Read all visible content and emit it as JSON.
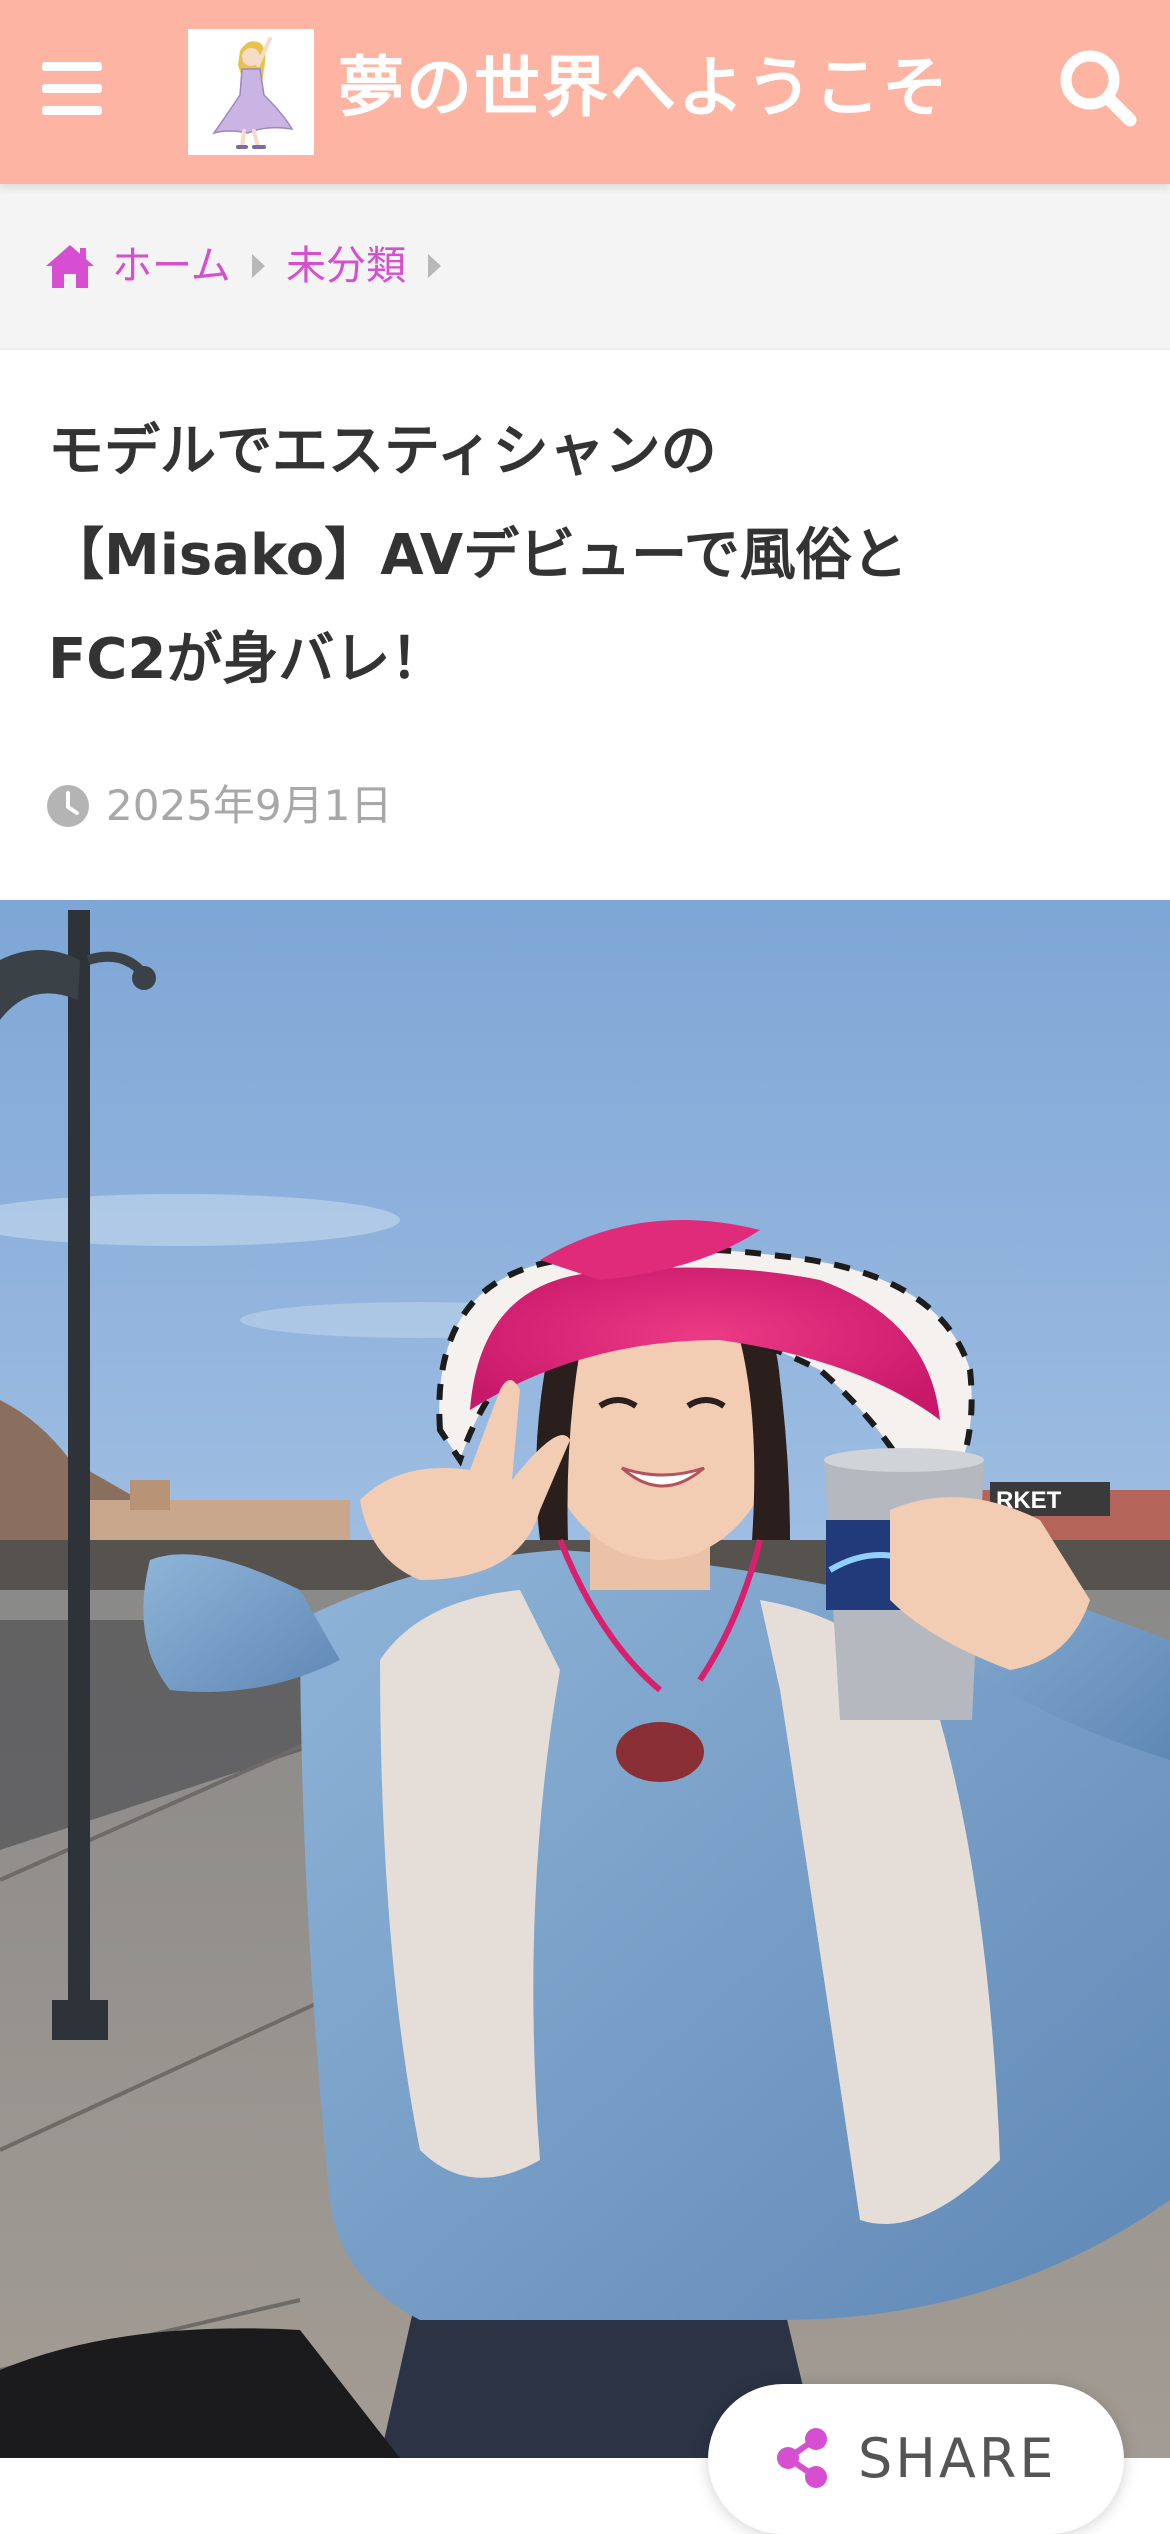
{
  "header": {
    "site_title": "夢の世界へようこそ",
    "menu_icon": "hamburger-menu-icon",
    "search_icon": "search-icon",
    "logo": "site-logo",
    "background_color": "#fdb4a2"
  },
  "breadcrumb": {
    "home_icon": "home-icon",
    "home_label": "ホーム",
    "category_label": "未分類",
    "link_color": "#d64fd0"
  },
  "article": {
    "title_line_1": "モデルでエスティシャンの",
    "title_line_2": "【Misako】AVデビューで風俗と",
    "title_line_3": "FC2が身バレ！",
    "date_icon": "clock-icon",
    "date": "2025年9月1日"
  },
  "share": {
    "label": "SHARE",
    "icon": "share-icon",
    "icon_color": "#d64fd0"
  }
}
